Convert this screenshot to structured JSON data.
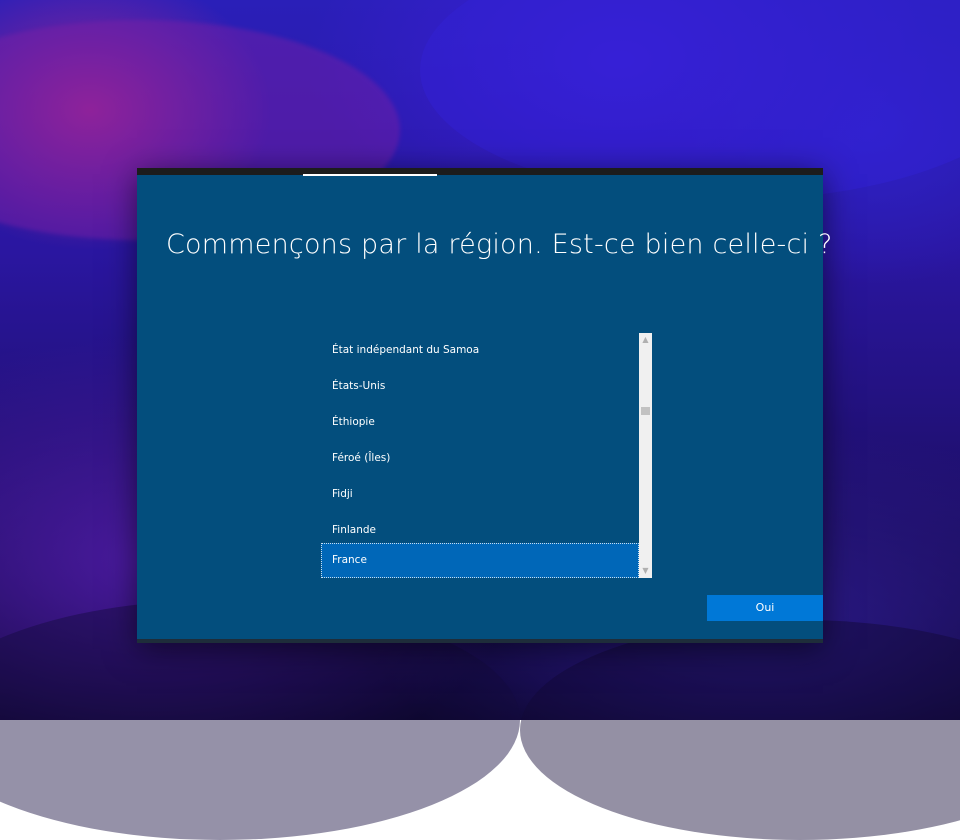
{
  "setup": {
    "title": "Commençons par la région. Est-ce bien celle-ci ?",
    "regions": [
      {
        "label": "État indépendant du Samoa",
        "selected": false
      },
      {
        "label": "États-Unis",
        "selected": false
      },
      {
        "label": "Éthiopie",
        "selected": false
      },
      {
        "label": "Féroé (Îles)",
        "selected": false
      },
      {
        "label": "Fidji",
        "selected": false
      },
      {
        "label": "Finlande",
        "selected": false
      },
      {
        "label": "France",
        "selected": true
      }
    ],
    "selected_region": "France",
    "yes_button_label": "Oui",
    "scroll_position": 0.32
  },
  "icons": {
    "scroll_up": "chevron-up-icon",
    "scroll_down": "chevron-down-icon"
  },
  "colors": {
    "panel_background": "#034e7d",
    "selection": "#0067b8",
    "button": "#0078d7"
  }
}
